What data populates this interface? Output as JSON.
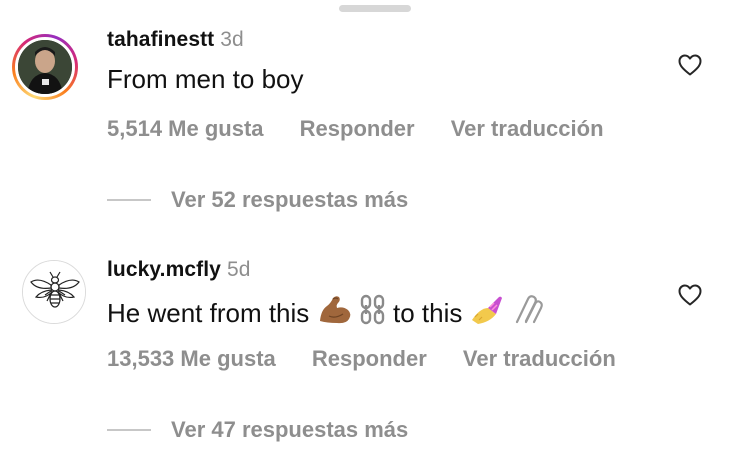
{
  "comments": [
    {
      "username": "tahafinestt",
      "time_ago": "3d",
      "text": "From men to boy",
      "likes_label": "5,514 Me gusta",
      "reply_label": "Responder",
      "translate_label": "Ver traducción",
      "more_replies_label": "Ver 52 respuestas más",
      "avatar_has_story_ring": true
    },
    {
      "username": "lucky.mcfly",
      "time_ago": "5d",
      "text_before": "He went from this",
      "text_middle": "to this",
      "emojis": [
        "flexed-biceps",
        "chains",
        "nail-polish",
        "paperclips"
      ],
      "likes_label": "13,533 Me gusta",
      "reply_label": "Responder",
      "translate_label": "Ver traducción",
      "more_replies_label": "Ver 47 respuestas más",
      "avatar_has_story_ring": false
    }
  ],
  "icons": {
    "like": "heart-outline-icon"
  },
  "colors": {
    "text_primary": "#111111",
    "text_secondary": "#8e8e8e",
    "story_ring": [
      "#feda75",
      "#fa7e1e",
      "#d62976",
      "#962fbf"
    ]
  }
}
